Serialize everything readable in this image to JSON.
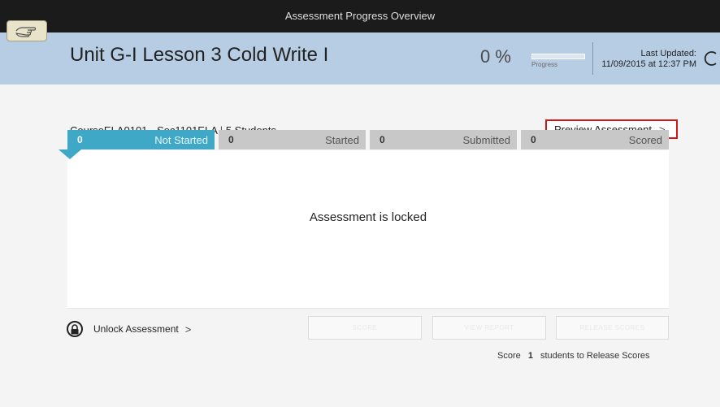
{
  "window": {
    "title": "Assessment Progress Overview"
  },
  "header": {
    "lesson_title": "Unit G-I Lesson 3 Cold Write I",
    "progress_percent": "0 %",
    "progress_value": 0,
    "progress_label": "Progress",
    "last_updated_label": "Last Updated:",
    "last_updated_value": "11/09/2015 at 12:37 PM"
  },
  "course": {
    "name": "CourseELA0101 - Sec1101ELA",
    "separator": "|",
    "student_count": "5",
    "students_label": "Students"
  },
  "preview": {
    "label": "Preview Assessment",
    "chevron": ">"
  },
  "tabs": [
    {
      "count": "0",
      "label": "Not Started"
    },
    {
      "count": "0",
      "label": "Started"
    },
    {
      "count": "0",
      "label": "Submitted"
    },
    {
      "count": "0",
      "label": "Scored"
    }
  ],
  "content": {
    "message": "Assessment is locked"
  },
  "unlock": {
    "label": "Unlock Assessment",
    "chevron": ">"
  },
  "actions": {
    "score": "SCORE",
    "view_report": "VIEW REPORT",
    "release_scores": "RELEASE SCORES"
  },
  "score_note": {
    "prefix": "Score",
    "count": "1",
    "suffix": "students to Release Scores"
  },
  "colors": {
    "titlebar_bg": "#1b1b1b",
    "header_bg": "#b7cde4",
    "active_tab": "#3fa8c6",
    "inactive_tab": "#c8c8c8",
    "highlight_border": "#d01818"
  },
  "icons": [
    "hand-pointer-icon",
    "refresh-icon",
    "lock-icon",
    "chevron-right-icon"
  ]
}
